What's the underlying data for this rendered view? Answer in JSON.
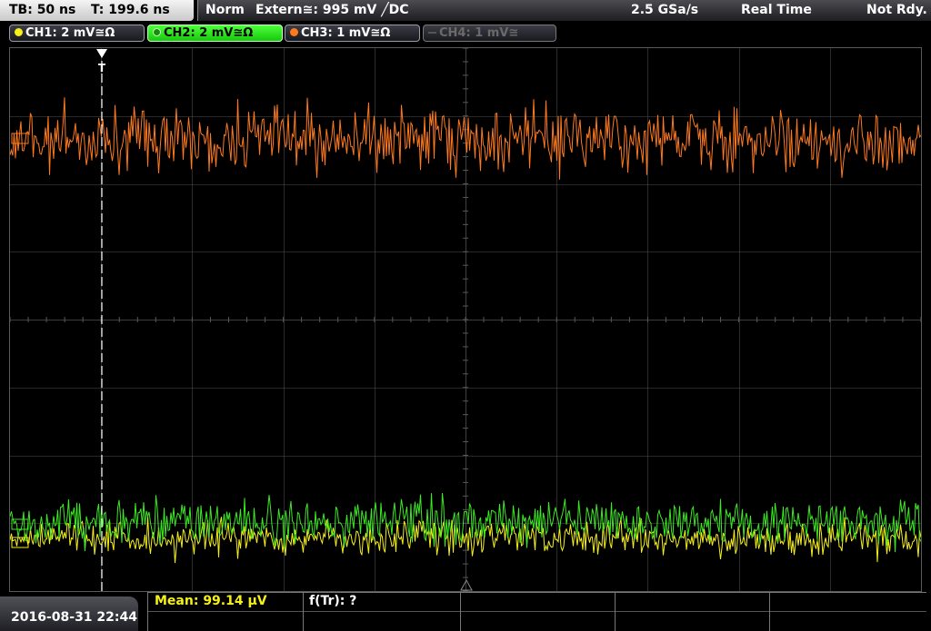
{
  "timebase": {
    "tb": "TB: 50 ns",
    "trigger_time": "T: 199.6 ns"
  },
  "status": {
    "mode": "Norm",
    "trigger_source": "Extern≅: 995 mV ╱DC",
    "sample_rate": "2.5 GSa/s",
    "acq_mode": "Real Time",
    "state": "Not Rdy."
  },
  "channels": [
    {
      "label": "CH1: 2 mV≅Ω",
      "color": "#f5f019",
      "active": true
    },
    {
      "label": "CH2: 2 mV≅Ω",
      "color": "#3cea23",
      "active": true,
      "selected": true
    },
    {
      "label": "CH3: 1 mV≅Ω",
      "color": "#ff7a1e",
      "active": true
    },
    {
      "label": "CH4: 1 mV≅",
      "color": "#6a6a6a",
      "active": false
    }
  ],
  "trace_colors": {
    "ch1": "#f5f019",
    "ch2": "#3cea23",
    "ch3": "#ff7a1e",
    "grid": "#5a5a5a",
    "trigger_line": "#ffffff"
  },
  "markers": {
    "trigger": "T"
  },
  "datetime": "2016-08-31 22:44",
  "measurements": {
    "mean": "Mean: 99.14 µV",
    "ftr": "f(Tr): ?"
  }
}
